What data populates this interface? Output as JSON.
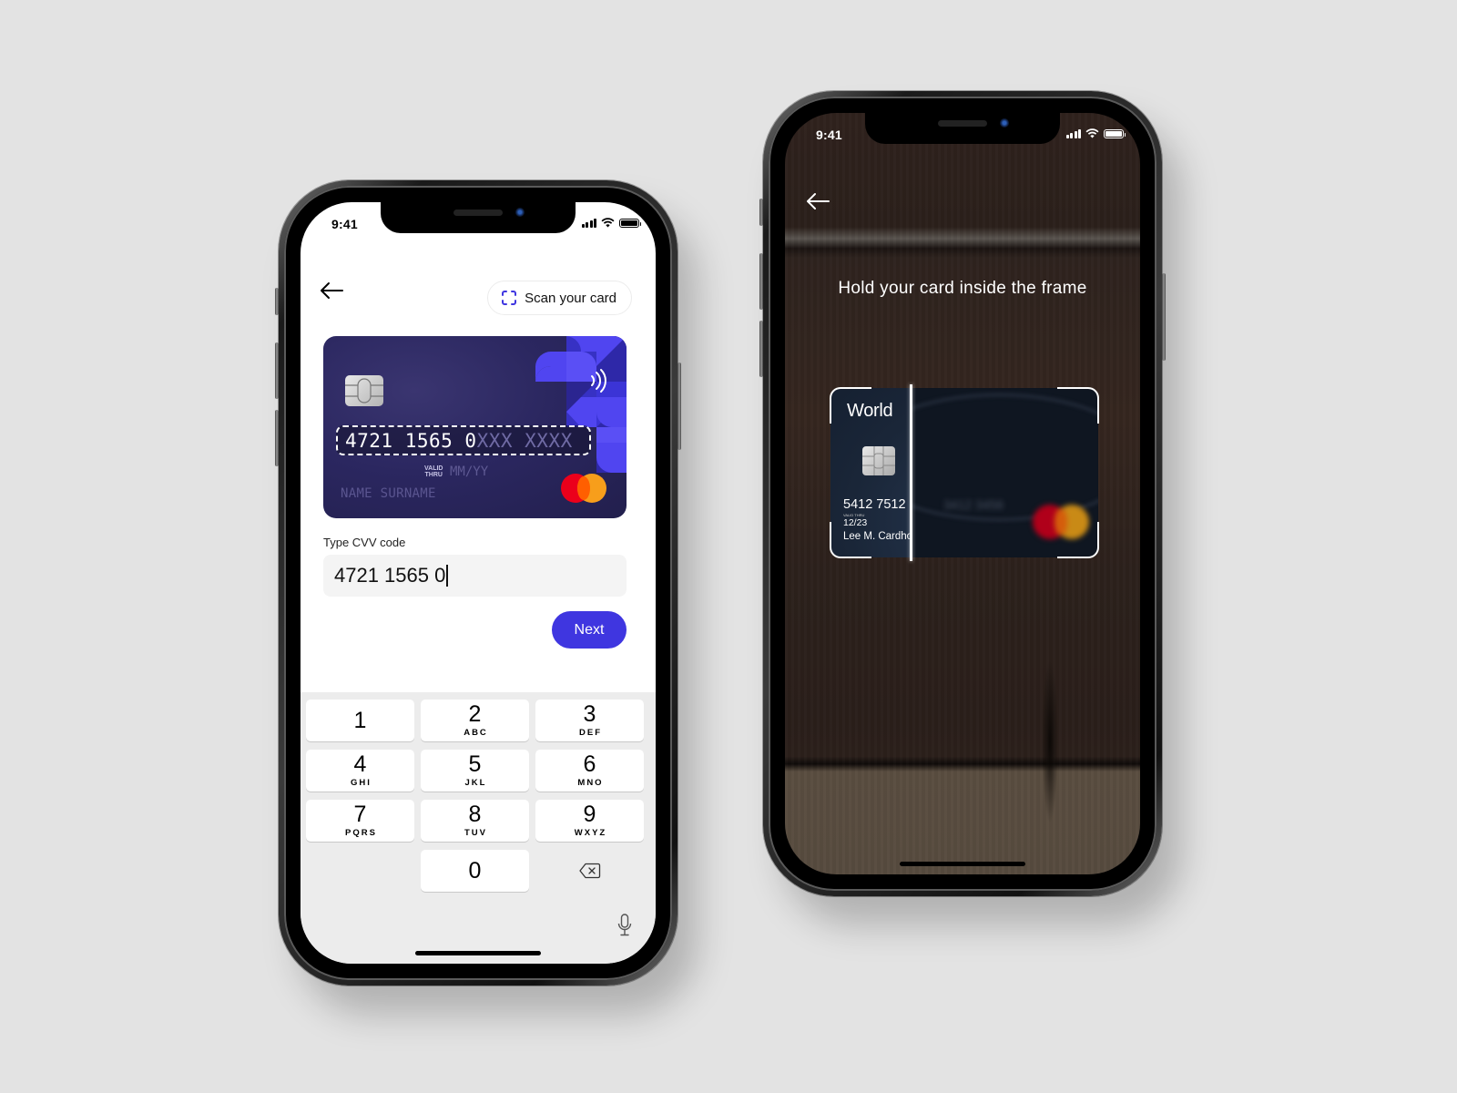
{
  "colors": {
    "accent": "#3f36e0",
    "card_bg": "#2b2760",
    "card_pattern": "#5045f0",
    "keypad_bg": "#ececec",
    "background": "#e3e3e3"
  },
  "left_phone": {
    "status_bar": {
      "time": "9:41"
    },
    "header": {
      "back_icon": "arrow-left-icon",
      "scan_button_label": "Scan your card",
      "scan_icon": "scan-frame-icon"
    },
    "card_preview": {
      "number_typed": "4721 1565 0",
      "number_mask": "XXX XXXX",
      "valid_thru_label_1": "VALID",
      "valid_thru_label_2": "THRU",
      "expiry_placeholder": "MM/YY",
      "name_placeholder": "NAME SURNAME",
      "network": "mastercard",
      "contactless_icon": "contactless-icon",
      "chip_icon": "chip-icon"
    },
    "form": {
      "label": "Type CVV code",
      "input_value": "4721 1565 0",
      "next_label": "Next"
    },
    "keypad": {
      "keys": [
        {
          "digit": "1",
          "letters": ""
        },
        {
          "digit": "2",
          "letters": "ABC"
        },
        {
          "digit": "3",
          "letters": "DEF"
        },
        {
          "digit": "4",
          "letters": "GHI"
        },
        {
          "digit": "5",
          "letters": "JKL"
        },
        {
          "digit": "6",
          "letters": "MNO"
        },
        {
          "digit": "7",
          "letters": "PQRS"
        },
        {
          "digit": "8",
          "letters": "TUV"
        },
        {
          "digit": "9",
          "letters": "WXYZ"
        },
        {
          "digit": "0",
          "letters": ""
        }
      ],
      "delete_icon": "backspace-icon",
      "mic_icon": "microphone-icon"
    }
  },
  "right_phone": {
    "status_bar": {
      "time": "9:41"
    },
    "back_icon": "arrow-left-icon",
    "instruction": "Hold your card inside the frame",
    "scanned_card": {
      "brand_text": "World",
      "number_visible": "5412 7512",
      "number_blurred": "3412 3456",
      "valid_thru_label": "VALID THRU",
      "expiry": "12/23",
      "name": "Lee M. Cardholder",
      "network": "mastercard"
    }
  }
}
